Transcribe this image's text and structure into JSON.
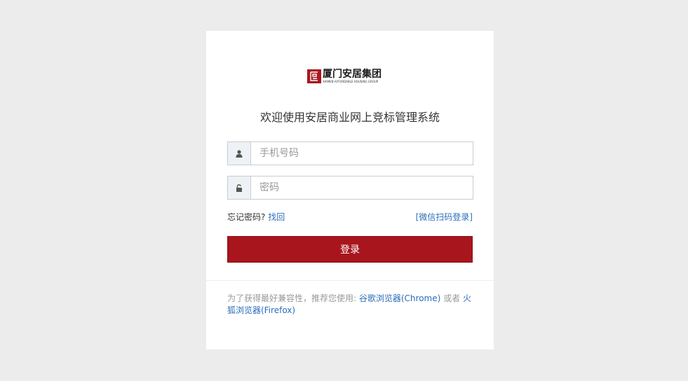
{
  "brand": {
    "name_cn": "厦门安居集团",
    "name_en": "XIAMEN AFFORDABLE HOUSING GROUP",
    "color": "#a81820"
  },
  "title": "欢迎使用安居商业网上竞标管理系统",
  "form": {
    "phone": {
      "placeholder": "手机号码",
      "icon": "user-icon"
    },
    "password": {
      "placeholder": "密码",
      "icon": "unlock-icon"
    },
    "forgot_text": "忘记密码?",
    "forgot_link": "找回",
    "wechat_login": "[微信扫码登录]",
    "login_button": "登录",
    "button_color": "#a8151d"
  },
  "browser_tip": {
    "prefix": "为了获得最好兼容性，推荐您使用: ",
    "chrome": "谷歌浏览器(Chrome)",
    "or": " 或者 ",
    "firefox": "火狐浏览器(Firefox)"
  }
}
